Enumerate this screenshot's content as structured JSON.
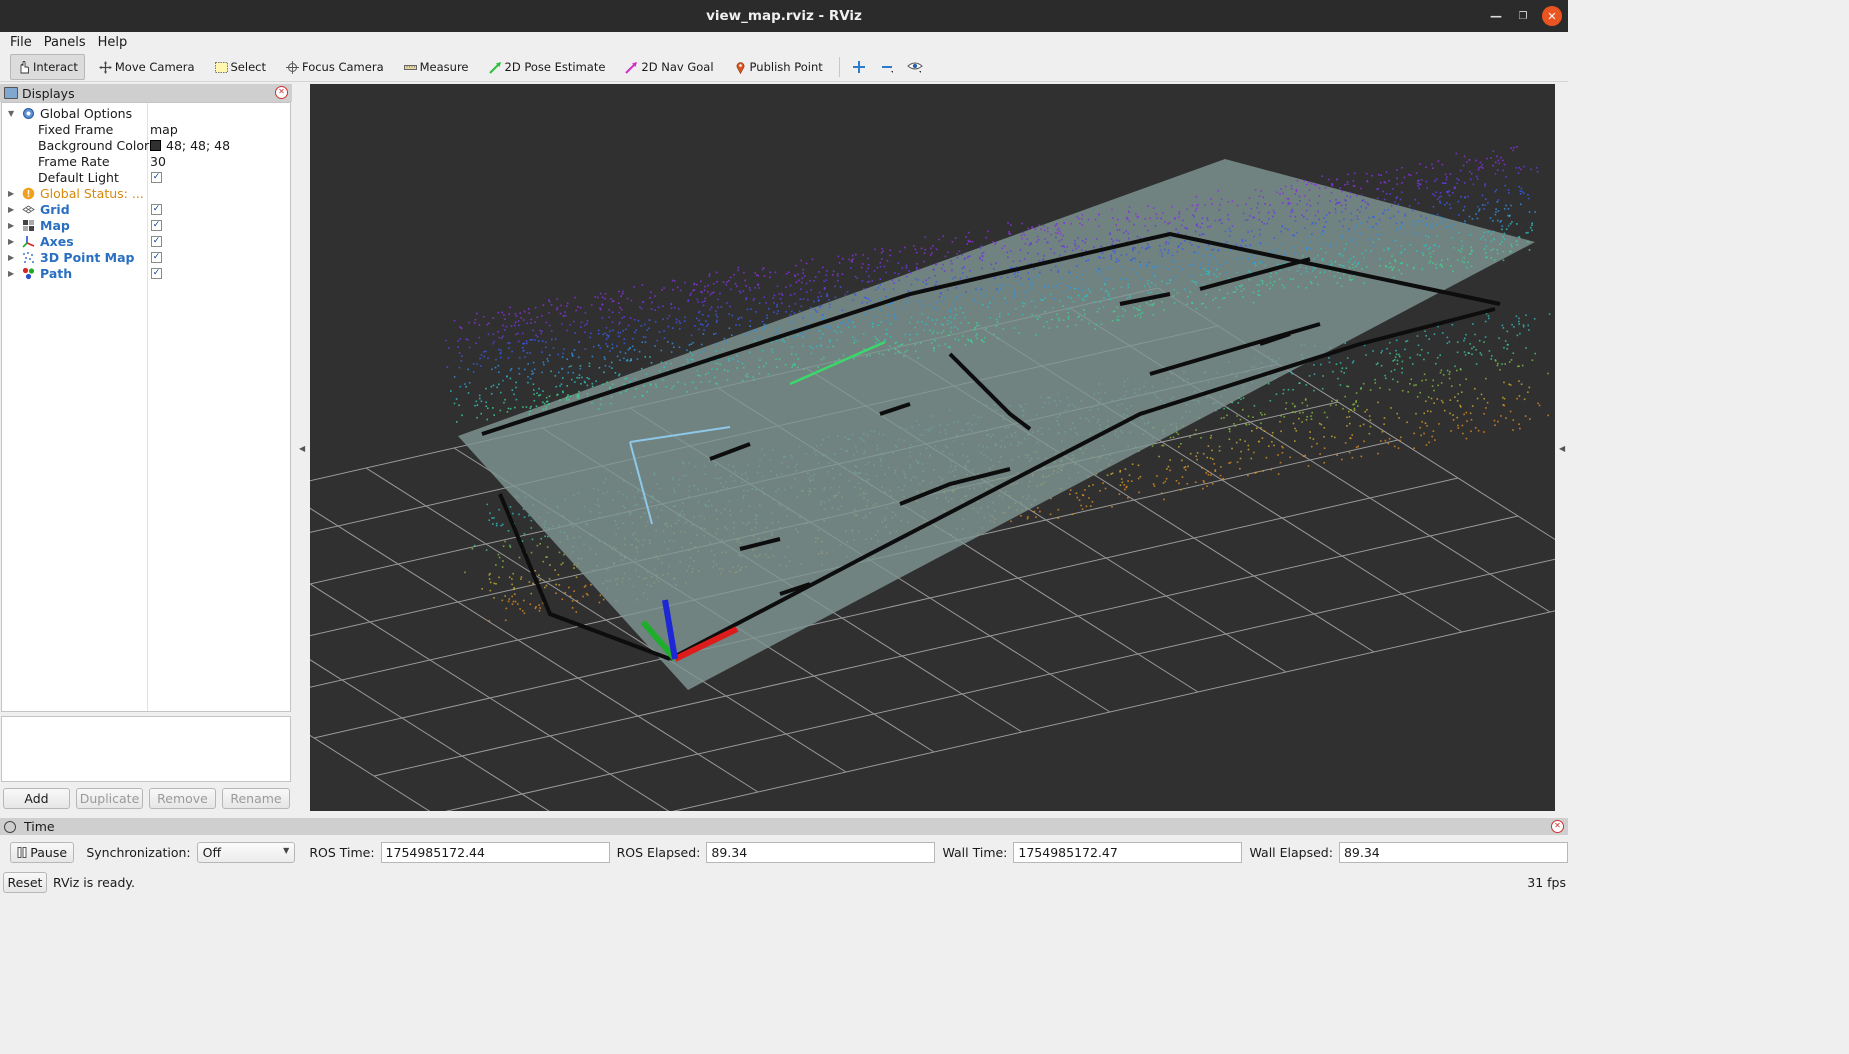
{
  "window": {
    "title": "view_map.rviz - RViz"
  },
  "menu": {
    "file": "File",
    "panels": "Panels",
    "help": "Help"
  },
  "toolbar": {
    "interact": "Interact",
    "move_camera": "Move Camera",
    "select": "Select",
    "focus_camera": "Focus Camera",
    "measure": "Measure",
    "pose_estimate": "2D Pose Estimate",
    "nav_goal": "2D Nav Goal",
    "publish_point": "Publish Point"
  },
  "displays": {
    "title": "Displays",
    "global_options": {
      "label": "Global Options",
      "fixed_frame_label": "Fixed Frame",
      "fixed_frame_value": "map",
      "bg_color_label": "Background Color",
      "bg_color_value": "48; 48; 48",
      "bg_color_hex": "#303030",
      "frame_rate_label": "Frame Rate",
      "frame_rate_value": "30",
      "default_light_label": "Default Light",
      "default_light_checked": true
    },
    "global_status": "Global Status: ...",
    "items": [
      {
        "label": "Grid",
        "icon": "grid-icon",
        "checked": true
      },
      {
        "label": "Map",
        "icon": "map-icon",
        "checked": true
      },
      {
        "label": "Axes",
        "icon": "axes-icon",
        "checked": true
      },
      {
        "label": "3D Point Map",
        "icon": "pointcloud-icon",
        "checked": true
      },
      {
        "label": "Path",
        "icon": "path-icon",
        "checked": true
      }
    ],
    "buttons": {
      "add": "Add",
      "duplicate": "Duplicate",
      "remove": "Remove",
      "rename": "Rename"
    }
  },
  "time": {
    "title": "Time",
    "pause": "Pause",
    "sync_label": "Synchronization:",
    "sync_value": "Off",
    "ros_time_label": "ROS Time:",
    "ros_time_value": "1754985172.44",
    "ros_elapsed_label": "ROS Elapsed:",
    "ros_elapsed_value": "89.34",
    "wall_time_label": "Wall Time:",
    "wall_time_value": "1754985172.47",
    "wall_elapsed_label": "Wall Elapsed:",
    "wall_elapsed_value": "89.34"
  },
  "status": {
    "reset": "Reset",
    "message": "RViz is ready.",
    "fps": "31 fps"
  }
}
